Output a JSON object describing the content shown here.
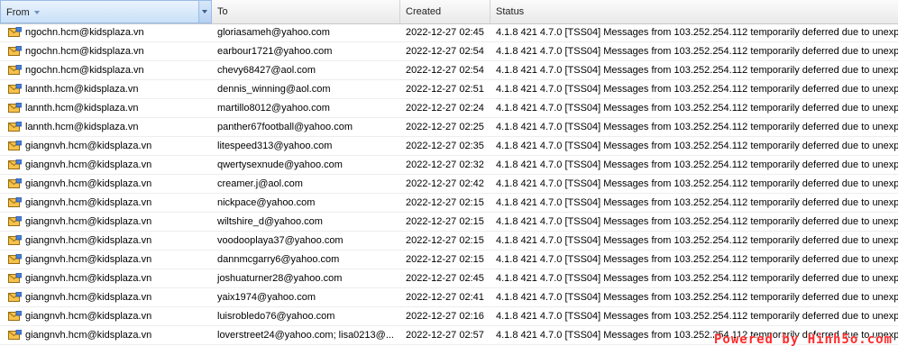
{
  "columns": {
    "from": "From",
    "to": "To",
    "created": "Created",
    "status": "Status"
  },
  "sort": {
    "column": "from",
    "direction": "descending"
  },
  "row_icon": "envelope-icon",
  "colors": {
    "sorted_header": "#c8e0f8",
    "header_border": "#99bbe8",
    "watermark": "#ff2a2a"
  },
  "rows": [
    {
      "from": "ngochn.hcm@kidsplaza.vn",
      "to": "gloriasameh@yahoo.com",
      "created": "2022-12-27 02:45",
      "status": "4.1.8 421 4.7.0 [TSS04] Messages from 103.252.254.112 temporarily deferred due to unexp"
    },
    {
      "from": "ngochn.hcm@kidsplaza.vn",
      "to": "earbour1721@yahoo.com",
      "created": "2022-12-27 02:54",
      "status": "4.1.8 421 4.7.0 [TSS04] Messages from 103.252.254.112 temporarily deferred due to unexp"
    },
    {
      "from": "ngochn.hcm@kidsplaza.vn",
      "to": "chevy68427@aol.com",
      "created": "2022-12-27 02:54",
      "status": "4.1.8 421 4.7.0 [TSS04] Messages from 103.252.254.112 temporarily deferred due to unexp"
    },
    {
      "from": "lannth.hcm@kidsplaza.vn",
      "to": "dennis_winning@aol.com",
      "created": "2022-12-27 02:51",
      "status": "4.1.8 421 4.7.0 [TSS04] Messages from 103.252.254.112 temporarily deferred due to unexp"
    },
    {
      "from": "lannth.hcm@kidsplaza.vn",
      "to": "martillo8012@yahoo.com",
      "created": "2022-12-27 02:24",
      "status": "4.1.8 421 4.7.0 [TSS04] Messages from 103.252.254.112 temporarily deferred due to unexp"
    },
    {
      "from": "lannth.hcm@kidsplaza.vn",
      "to": "panther67football@yahoo.com",
      "created": "2022-12-27 02:25",
      "status": "4.1.8 421 4.7.0 [TSS04] Messages from 103.252.254.112 temporarily deferred due to unexp"
    },
    {
      "from": "giangnvh.hcm@kidsplaza.vn",
      "to": "litespeed313@yahoo.com",
      "created": "2022-12-27 02:35",
      "status": "4.1.8 421 4.7.0 [TSS04] Messages from 103.252.254.112 temporarily deferred due to unexp"
    },
    {
      "from": "giangnvh.hcm@kidsplaza.vn",
      "to": "qwertysexnude@yahoo.com",
      "created": "2022-12-27 02:32",
      "status": "4.1.8 421 4.7.0 [TSS04] Messages from 103.252.254.112 temporarily deferred due to unexp"
    },
    {
      "from": "giangnvh.hcm@kidsplaza.vn",
      "to": "creamer.j@aol.com",
      "created": "2022-12-27 02:42",
      "status": "4.1.8 421 4.7.0 [TSS04] Messages from 103.252.254.112 temporarily deferred due to unexp"
    },
    {
      "from": "giangnvh.hcm@kidsplaza.vn",
      "to": "nickpace@yahoo.com",
      "created": "2022-12-27 02:15",
      "status": "4.1.8 421 4.7.0 [TSS04] Messages from 103.252.254.112 temporarily deferred due to unexp"
    },
    {
      "from": "giangnvh.hcm@kidsplaza.vn",
      "to": "wiltshire_d@yahoo.com",
      "created": "2022-12-27 02:15",
      "status": "4.1.8 421 4.7.0 [TSS04] Messages from 103.252.254.112 temporarily deferred due to unexp"
    },
    {
      "from": "giangnvh.hcm@kidsplaza.vn",
      "to": "voodooplaya37@yahoo.com",
      "created": "2022-12-27 02:15",
      "status": "4.1.8 421 4.7.0 [TSS04] Messages from 103.252.254.112 temporarily deferred due to unexp"
    },
    {
      "from": "giangnvh.hcm@kidsplaza.vn",
      "to": "dannmcgarry6@yahoo.com",
      "created": "2022-12-27 02:15",
      "status": "4.1.8 421 4.7.0 [TSS04] Messages from 103.252.254.112 temporarily deferred due to unexp"
    },
    {
      "from": "giangnvh.hcm@kidsplaza.vn",
      "to": "joshuaturner28@yahoo.com",
      "created": "2022-12-27 02:45",
      "status": "4.1.8 421 4.7.0 [TSS04] Messages from 103.252.254.112 temporarily deferred due to unexp"
    },
    {
      "from": "giangnvh.hcm@kidsplaza.vn",
      "to": "yaix1974@yahoo.com",
      "created": "2022-12-27 02:41",
      "status": "4.1.8 421 4.7.0 [TSS04] Messages from 103.252.254.112 temporarily deferred due to unexp"
    },
    {
      "from": "giangnvh.hcm@kidsplaza.vn",
      "to": "luisrobledo76@yahoo.com",
      "created": "2022-12-27 02:16",
      "status": "4.1.8 421 4.7.0 [TSS04] Messages from 103.252.254.112 temporarily deferred due to unexp"
    },
    {
      "from": "giangnvh.hcm@kidsplaza.vn",
      "to": "loverstreet24@yahoo.com; lisa0213@...",
      "created": "2022-12-27 02:57",
      "status": "4.1.8 421 4.7.0 [TSS04] Messages from 103.252.254.112 temporarily deferred due to unexp"
    }
  ],
  "watermark": "Powered by Hinh5o.com"
}
